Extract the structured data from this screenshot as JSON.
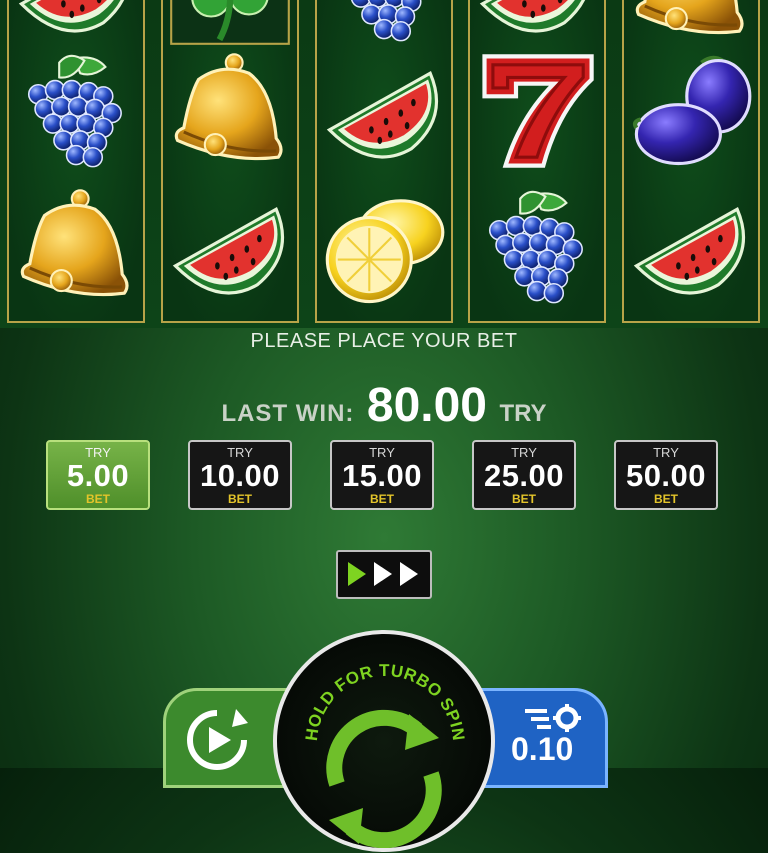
{
  "game": {
    "prompt": "PLEASE PLACE YOUR BET",
    "last_win_label": "LAST WIN:",
    "last_win_value": "80.00",
    "currency": "TRY",
    "reels": [
      [
        "watermelon",
        "grapes",
        "bell"
      ],
      [
        "clover",
        "bell",
        "watermelon"
      ],
      [
        "grapes",
        "watermelon",
        "lemon"
      ],
      [
        "watermelon",
        "seven",
        "grapes"
      ],
      [
        "bell",
        "plums",
        "watermelon"
      ]
    ]
  },
  "bets": [
    {
      "currency": "TRY",
      "amount": "5.00",
      "label": "BET",
      "selected": true
    },
    {
      "currency": "TRY",
      "amount": "10.00",
      "label": "BET",
      "selected": false
    },
    {
      "currency": "TRY",
      "amount": "15.00",
      "label": "BET",
      "selected": false
    },
    {
      "currency": "TRY",
      "amount": "25.00",
      "label": "BET",
      "selected": false
    },
    {
      "currency": "TRY",
      "amount": "50.00",
      "label": "BET",
      "selected": false
    }
  ],
  "controls": {
    "spin_label": "HOLD FOR TURBO SPIN",
    "speed_value": "0.10",
    "icons": [
      "fast-forward-icon",
      "autoplay-icon",
      "spin-arrows-icon",
      "speed-settings-icon"
    ]
  }
}
